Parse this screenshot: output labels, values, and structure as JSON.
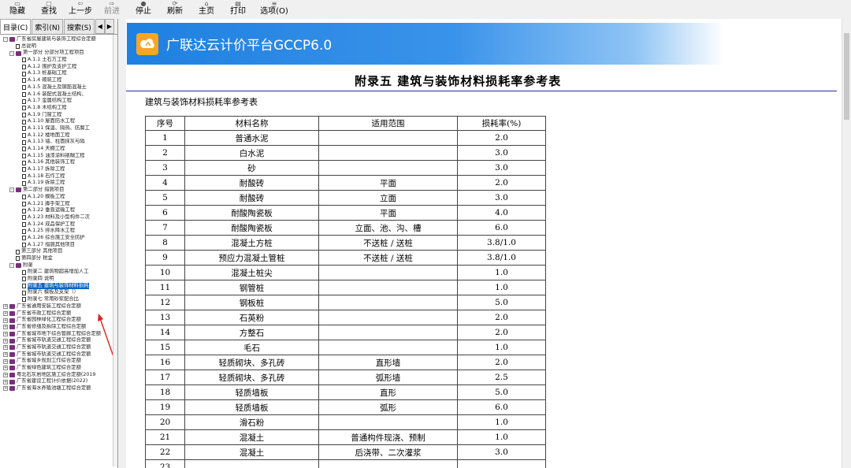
{
  "toolbar": {
    "buttons": [
      {
        "label": "隐藏",
        "icon": "hide-icon"
      },
      {
        "label": "查找",
        "icon": "find-icon"
      },
      {
        "label": "上一步",
        "icon": "back-icon"
      },
      {
        "label": "前进",
        "icon": "forward-icon",
        "disabled": true
      },
      {
        "label": "停止",
        "icon": "stop-icon"
      },
      {
        "label": "刷新",
        "icon": "refresh-icon"
      },
      {
        "label": "主页",
        "icon": "home-icon"
      },
      {
        "label": "打印",
        "icon": "print-icon"
      },
      {
        "label": "选项(O)",
        "icon": "options-icon"
      }
    ]
  },
  "left_panel": {
    "tabs": [
      "目录(C)",
      "索引(N)",
      "搜索(S)"
    ],
    "tree": [
      {
        "level": 0,
        "type": "book",
        "exp": "-",
        "label": "广东省房屋建筑与装饰工程综合定额"
      },
      {
        "level": 1,
        "type": "doc",
        "label": "总说明"
      },
      {
        "level": 1,
        "type": "book",
        "exp": "-",
        "label": "第一部分 分部分项工程项目"
      },
      {
        "level": 2,
        "type": "doc",
        "label": "A.1.1 土石方工程"
      },
      {
        "level": 2,
        "type": "doc",
        "label": "A.1.2 围护及支护工程"
      },
      {
        "level": 2,
        "type": "doc",
        "label": "A.1.3 桩基础工程"
      },
      {
        "level": 2,
        "type": "doc",
        "label": "A.1.4 砌筑工程"
      },
      {
        "level": 2,
        "type": "doc",
        "label": "A.1.5 混凝土及钢筋混凝土"
      },
      {
        "level": 2,
        "type": "doc",
        "label": "A.1.6 装配式混凝土结构、"
      },
      {
        "level": 2,
        "type": "doc",
        "label": "A.1.7 金属结构工程"
      },
      {
        "level": 2,
        "type": "doc",
        "label": "A.1.8 木结构工程"
      },
      {
        "level": 2,
        "type": "doc",
        "label": "A.1.9 门窗工程"
      },
      {
        "level": 2,
        "type": "doc",
        "label": "A.1.10 屋面防水工程"
      },
      {
        "level": 2,
        "type": "doc",
        "label": "A.1.11 保温、隔热、防腐工"
      },
      {
        "level": 2,
        "type": "doc",
        "label": "A.1.12 楼地面工程"
      },
      {
        "level": 2,
        "type": "doc",
        "label": "A.1.13 墙、柱面抹灰与隔"
      },
      {
        "level": 2,
        "type": "doc",
        "label": "A.1.14 天棚工程"
      },
      {
        "level": 2,
        "type": "doc",
        "label": "A.1.15 油漆涂料裱糊工程"
      },
      {
        "level": 2,
        "type": "doc",
        "label": "A.1.16 其他装饰工程"
      },
      {
        "level": 2,
        "type": "doc",
        "label": "A.1.17 拆除工程"
      },
      {
        "level": 2,
        "type": "doc",
        "label": "A.1.18 石作工程"
      },
      {
        "level": 2,
        "type": "doc",
        "label": "A.1.19 拆除工程"
      },
      {
        "level": 1,
        "type": "book",
        "exp": "-",
        "label": "第二部分 措施项目"
      },
      {
        "level": 2,
        "type": "doc",
        "label": "A.1.20 模板工程"
      },
      {
        "level": 2,
        "type": "doc",
        "label": "A.1.21 脚手架工程"
      },
      {
        "level": 2,
        "type": "doc",
        "label": "A.1.22 垂直运输工程"
      },
      {
        "level": 2,
        "type": "doc",
        "label": "A.1.23 材料及小型构件二次"
      },
      {
        "level": 2,
        "type": "doc",
        "label": "A.1.24 成品保护工程"
      },
      {
        "level": 2,
        "type": "doc",
        "label": "A.1.25 排水降水工程"
      },
      {
        "level": 2,
        "type": "doc",
        "label": "A.1.26 综合施工安全防护"
      },
      {
        "level": 2,
        "type": "doc",
        "label": "A.1.27 措施其他项目"
      },
      {
        "level": 1,
        "type": "doc",
        "label": "第三部分 其他项目"
      },
      {
        "level": 1,
        "type": "doc",
        "label": "第四部分 税金"
      },
      {
        "level": 1,
        "type": "book",
        "exp": "-",
        "label": "附录"
      },
      {
        "level": 2,
        "type": "doc",
        "label": "附录二 建筑物超高增加人工"
      },
      {
        "level": 2,
        "type": "doc",
        "label": "附录四 说明"
      },
      {
        "level": 2,
        "type": "doc",
        "label": "附录五 建筑与装饰材料损耗",
        "selected": true
      },
      {
        "level": 2,
        "type": "doc",
        "label": "附录六 模板及支架（）"
      },
      {
        "level": 2,
        "type": "doc",
        "label": "附录七 常用砂浆配合比"
      },
      {
        "level": 0,
        "type": "book",
        "exp": "+",
        "label": "广东省通用安装工程综合定额"
      },
      {
        "level": 0,
        "type": "book",
        "exp": "+",
        "label": "广东省市政工程综合定额"
      },
      {
        "level": 0,
        "type": "book",
        "exp": "+",
        "label": "广东省园林绿化工程综合定额"
      },
      {
        "level": 0,
        "type": "book",
        "exp": "+",
        "label": "广东省修缮及拆除工程综合定额"
      },
      {
        "level": 0,
        "type": "book",
        "exp": "+",
        "label": "广东省城市地下综合管廊工程综合定额"
      },
      {
        "level": 0,
        "type": "book",
        "exp": "+",
        "label": "广东省城市轨道交通工程综合定额"
      },
      {
        "level": 0,
        "type": "book",
        "exp": "+",
        "label": "广东省城市轨道交通工程综合定额"
      },
      {
        "level": 0,
        "type": "book",
        "exp": "+",
        "label": "广东省城市轨道交通工程综合定额"
      },
      {
        "level": 0,
        "type": "book",
        "exp": "+",
        "label": "广东省城乡规划工作综合定额"
      },
      {
        "level": 0,
        "type": "book",
        "exp": "+",
        "label": "广东省绿色建筑工程综合定额"
      },
      {
        "level": 0,
        "type": "book",
        "exp": "+",
        "label": "粤北石灰岩地区施工综合定额(2019"
      },
      {
        "level": 0,
        "type": "book",
        "exp": "+",
        "label": "广东省建设工程计价依据(2022)"
      },
      {
        "level": 0,
        "type": "book",
        "exp": "+",
        "label": "广东省海水养殖池塘工程综合定额"
      }
    ]
  },
  "banner": {
    "title": "广联达云计价平台GCCP6.0",
    "color_start": "#1e80e0",
    "logo_color": "#f6a623"
  },
  "document": {
    "heading": "附录五  建筑与装饰材料损耗率参考表",
    "subtitle": "建筑与装饰材料损耗率参考表",
    "columns": [
      "序号",
      "材料名称",
      "适用范围",
      "损耗率(%)"
    ],
    "rows": [
      [
        "1",
        "普通水泥",
        "",
        "2.0"
      ],
      [
        "2",
        "白水泥",
        "",
        "3.0"
      ],
      [
        "3",
        "砂",
        "",
        "3.0"
      ],
      [
        "4",
        "耐酸砖",
        "平面",
        "2.0"
      ],
      [
        "5",
        "耐酸砖",
        "立面",
        "3.0"
      ],
      [
        "6",
        "耐酸陶瓷板",
        "平面",
        "4.0"
      ],
      [
        "7",
        "耐酸陶瓷板",
        "立面、池、沟、槽",
        "6.0"
      ],
      [
        "8",
        "混凝土方桩",
        "不送桩 / 送桩",
        "3.8/1.0"
      ],
      [
        "9",
        "预应力混凝土管桩",
        "不送桩 / 送桩",
        "3.8/1.0"
      ],
      [
        "10",
        "混凝土桩尖",
        "",
        "1.0"
      ],
      [
        "11",
        "钢管桩",
        "",
        "1.0"
      ],
      [
        "12",
        "钢板桩",
        "",
        "5.0"
      ],
      [
        "13",
        "石英粉",
        "",
        "2.0"
      ],
      [
        "14",
        "方整石",
        "",
        "2.0"
      ],
      [
        "15",
        "毛石",
        "",
        "1.0"
      ],
      [
        "16",
        "轻质砌块、多孔砖",
        "直形墙",
        "2.0"
      ],
      [
        "17",
        "轻质砌块、多孔砖",
        "弧形墙",
        "2.5"
      ],
      [
        "18",
        "轻质墙板",
        "直形",
        "5.0"
      ],
      [
        "19",
        "轻质墙板",
        "弧形",
        "6.0"
      ],
      [
        "20",
        "滑石粉",
        "",
        "1.0"
      ],
      [
        "21",
        "混凝土",
        "普通构件现浇、预制",
        "1.0"
      ],
      [
        "22",
        "混凝土",
        "后浇带、二次灌浆",
        "3.0"
      ],
      [
        "23",
        "",
        "",
        ""
      ]
    ]
  }
}
